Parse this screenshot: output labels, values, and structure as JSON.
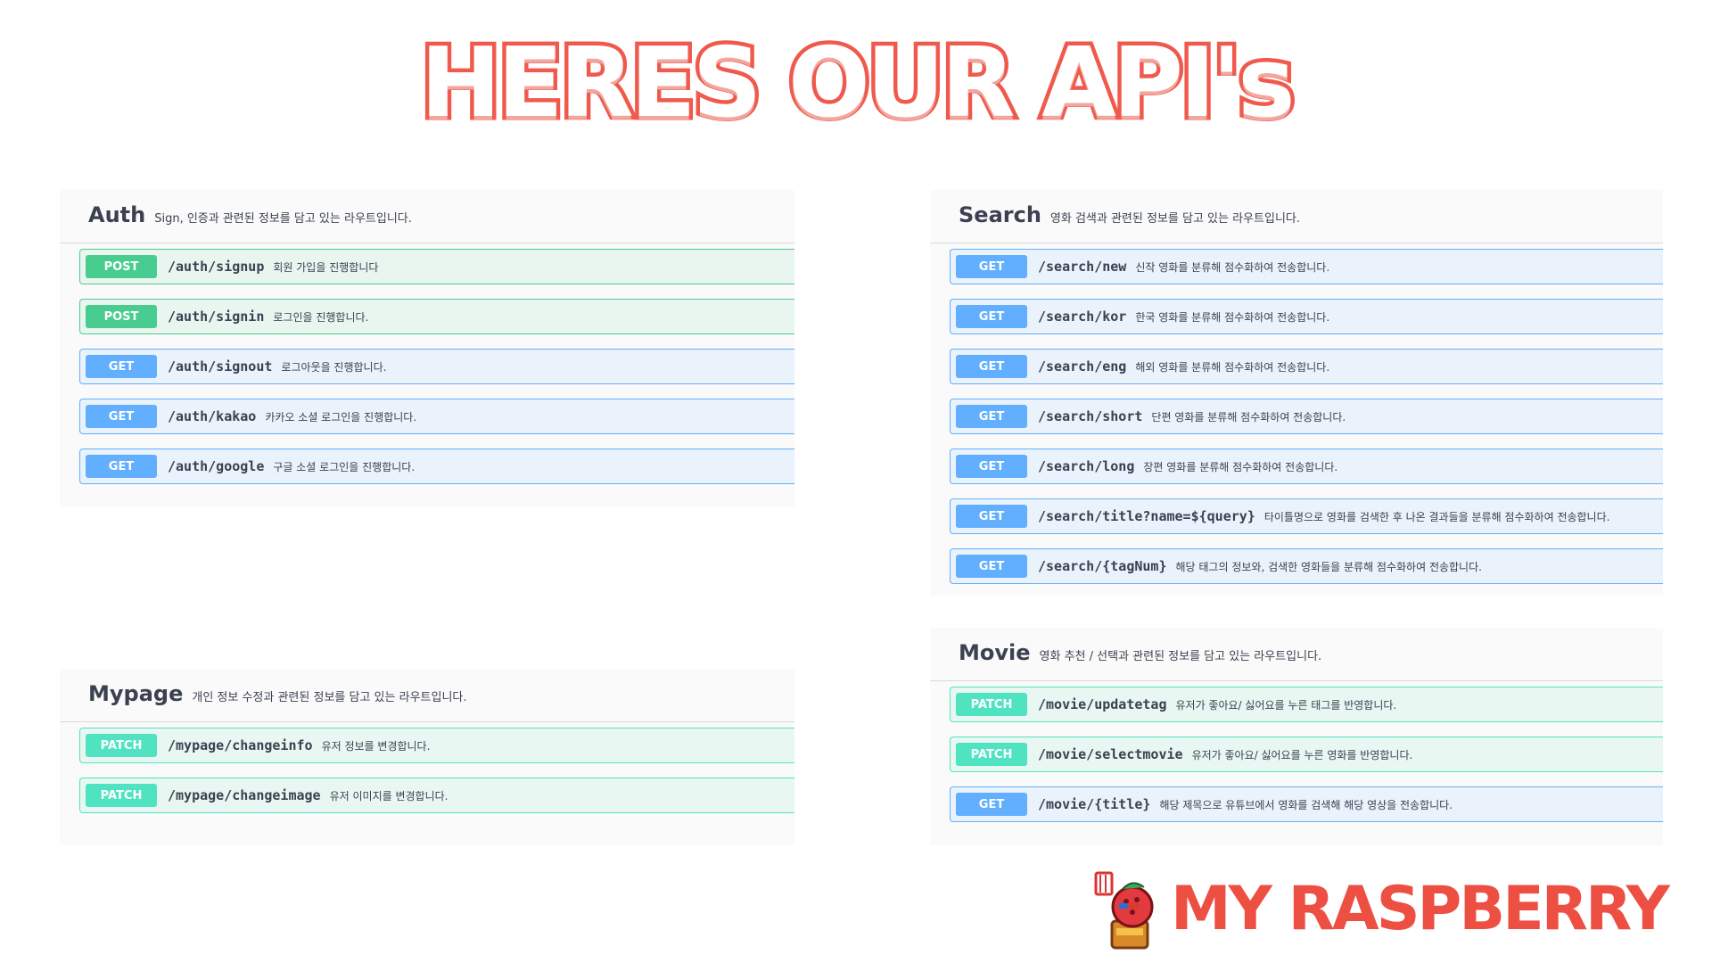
{
  "title": "HERES OUR API's",
  "panels": [
    {
      "name": "Auth",
      "description": "Sign, 인증과 관련된 정보를 담고 있는 라우트입니다.",
      "operations": [
        {
          "method": "POST",
          "path": "/auth/signup",
          "summary": "회원 가입을 진행합니다"
        },
        {
          "method": "POST",
          "path": "/auth/signin",
          "summary": "로그인을 진행합니다."
        },
        {
          "method": "GET",
          "path": "/auth/signout",
          "summary": "로그아웃을 진행합니다."
        },
        {
          "method": "GET",
          "path": "/auth/kakao",
          "summary": "카카오 소셜 로그인을 진행합니다."
        },
        {
          "method": "GET",
          "path": "/auth/google",
          "summary": "구글 소셜 로그인을 진행합니다."
        }
      ]
    },
    {
      "name": "Search",
      "description": "영화 검색과 관련된 정보를 담고 있는 라우트입니다.",
      "operations": [
        {
          "method": "GET",
          "path": "/search/new",
          "summary": "신작 영화를 분류해 점수화하여 전송합니다."
        },
        {
          "method": "GET",
          "path": "/search/kor",
          "summary": "한국 영화를 분류해 점수화하여 전송합니다."
        },
        {
          "method": "GET",
          "path": "/search/eng",
          "summary": "해외 영화를 분류해 점수화하여 전송합니다."
        },
        {
          "method": "GET",
          "path": "/search/short",
          "summary": "단편 영화를 분류해 점수화하여 전송합니다."
        },
        {
          "method": "GET",
          "path": "/search/long",
          "summary": "장편 영화를 분류해 점수화하여 전송합니다."
        },
        {
          "method": "GET",
          "path": "/search/title?name=${query}",
          "summary": "타이틀명으로 영화를 검색한 후 나온 결과들을 분류해 점수화하여 전송합니다."
        },
        {
          "method": "GET",
          "path": "/search/{tagNum}",
          "summary": "해당 태그의 정보와, 검색한 영화들을 분류해 점수화하여 전송합니다."
        }
      ]
    },
    {
      "name": "Mypage",
      "description": "개인 정보 수정과 관련된 정보를 담고 있는 라우트입니다.",
      "operations": [
        {
          "method": "PATCH",
          "path": "/mypage/changeinfo",
          "summary": "유저 정보를 변경합니다."
        },
        {
          "method": "PATCH",
          "path": "/mypage/changeimage",
          "summary": "유저 이미지를 변경합니다."
        }
      ]
    },
    {
      "name": "Movie",
      "description": "영화 추천 / 선택과 관련된 정보를 담고 있는 라우트입니다.",
      "operations": [
        {
          "method": "PATCH",
          "path": "/movie/updatetag",
          "summary": "유저가 좋아요/ 싫어요를 누른 태그를 반영합니다."
        },
        {
          "method": "PATCH",
          "path": "/movie/selectmovie",
          "summary": "유저가 좋아요/ 싫어요를 누른 영화를 반영합니다."
        },
        {
          "method": "GET",
          "path": "/movie/{title}",
          "summary": "해당 제목으로 유튜브에서 영화를 검색해 해당 영상을 전송합니다."
        }
      ]
    }
  ],
  "logo": {
    "text": "MY RASPBERRY"
  },
  "colors": {
    "get": "#61affe",
    "post": "#49cc90",
    "patch": "#50e3c2",
    "title": "#ef5a4d"
  }
}
